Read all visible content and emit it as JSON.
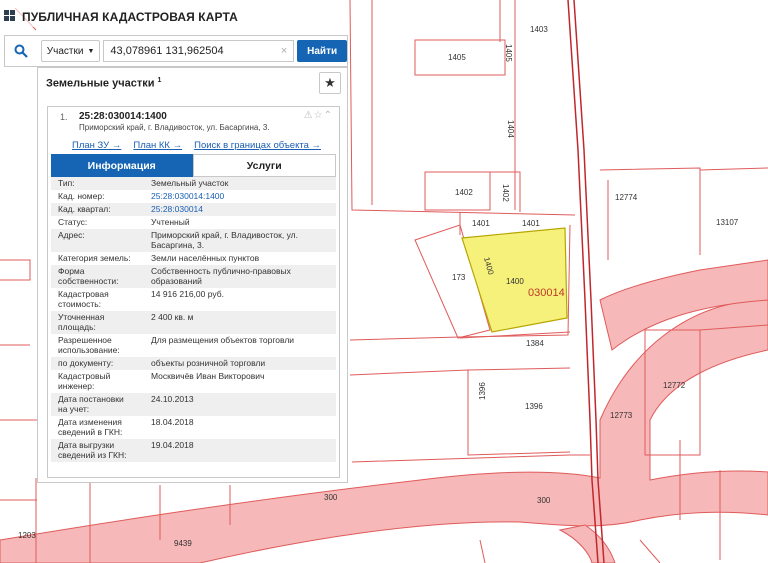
{
  "header": {
    "title": "ПУБЛИЧНАЯ КАДАСТРОВАЯ КАРТА"
  },
  "search": {
    "type_label": "Участки",
    "query": "43,078961 131,962504",
    "clear_glyph": "×",
    "button_label": "Найти"
  },
  "panel": {
    "title": "Земельные участки",
    "count": "1",
    "star_glyph": "★"
  },
  "result": {
    "index": "1.",
    "cad_number": "25:28:030014:1400",
    "address": "Приморский край, г. Владивосток, ул. Басаргина, 3.",
    "tool_glyphs": "⚠☆⌃",
    "links": [
      "План ЗУ →",
      "План КК →",
      "Поиск в границах объекта →"
    ],
    "tabs": [
      "Информация",
      "Услуги"
    ],
    "attributes": [
      {
        "k": [
          "Тип:"
        ],
        "v": [
          "Земельный участок"
        ]
      },
      {
        "k": [
          "Кад. номер:"
        ],
        "v": [
          "25:28:030014:1400"
        ],
        "link": true
      },
      {
        "k": [
          "Кад. квартал:"
        ],
        "v": [
          "25:28:030014"
        ],
        "link": true
      },
      {
        "k": [
          "Статус:"
        ],
        "v": [
          "Учтенный"
        ]
      },
      {
        "k": [
          "Адрес:"
        ],
        "v": [
          "Приморский край, г. Владивосток, ул.",
          "Басаргина, 3."
        ]
      },
      {
        "k": [
          "Категория земель:"
        ],
        "v": [
          "Земли населённых пунктов"
        ]
      },
      {
        "k": [
          "Форма",
          "собственности:"
        ],
        "v": [
          "Собственность публично-правовых",
          "образований"
        ]
      },
      {
        "k": [
          "Кадастровая",
          "стоимость:"
        ],
        "v": [
          "14 916 216,00 руб."
        ]
      },
      {
        "k": [
          "Уточненная",
          "площадь:"
        ],
        "v": [
          "2 400 кв. м"
        ]
      },
      {
        "k": [
          "Разрешенное",
          "использование:"
        ],
        "v": [
          "Для размещения объектов торговли"
        ]
      },
      {
        "k": [
          "по документу:"
        ],
        "v": [
          "объекты розничной торговли"
        ]
      },
      {
        "k": [
          "Кадастровый",
          "инженер:"
        ],
        "v": [
          "Москвичёв Иван Викторович"
        ]
      },
      {
        "k": [
          "Дата постановки",
          "на учет:"
        ],
        "v": [
          "24.10.2013"
        ]
      },
      {
        "k": [
          "Дата изменения",
          "сведений в ГКН:"
        ],
        "v": [
          "18.04.2018"
        ]
      },
      {
        "k": [
          "Дата выгрузки",
          "сведений из ГКН:"
        ],
        "v": [
          "19.04.2018"
        ]
      }
    ]
  },
  "map_labels": {
    "l1403": "1403",
    "l1405": "1405",
    "l1405v": "1405",
    "l1404v": "1404",
    "l1402": "1402",
    "l1402v": "1402",
    "l1401a": "1401",
    "l1401b": "1401",
    "l12774": "12774",
    "l13107": "13107",
    "l173": "173",
    "l1400": "1400",
    "l1400v": "1400",
    "quarter": "030014",
    "l1384": "1384",
    "l12772": "12772",
    "l1396v": "1396",
    "l1396": "1396",
    "l12773": "12773",
    "l300a": "300",
    "l300b": "300",
    "l1203": "1203",
    "l9439": "9439"
  },
  "colors": {
    "accent": "#1565b4",
    "selected_parcel": "#f5f17a",
    "road_zone": "#f6b8b8",
    "boundary": "#e05b5b",
    "rail": "#c0272d"
  }
}
